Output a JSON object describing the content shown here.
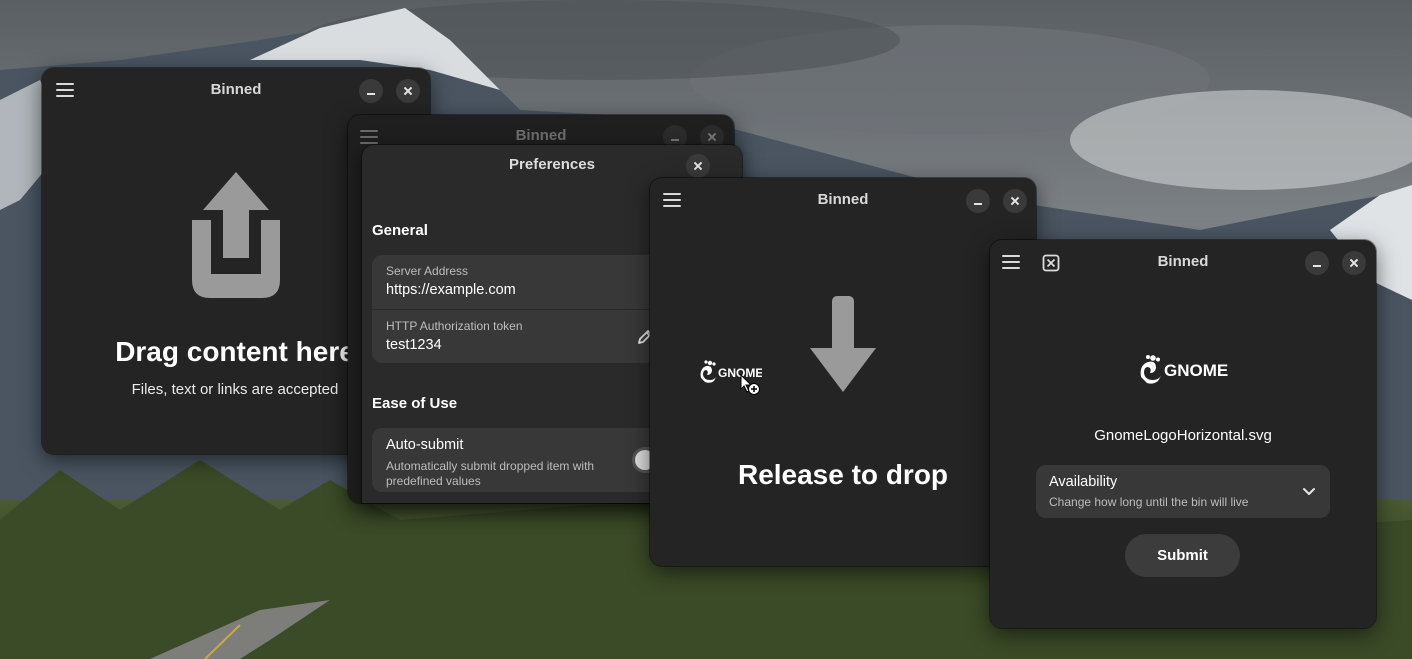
{
  "windows": {
    "main": {
      "title": "Binned",
      "heading": "Drag content here",
      "subtitle": "Files, text or links are accepted"
    },
    "background": {
      "title": "Binned"
    },
    "preferences": {
      "title": "Preferences",
      "general_title": "General",
      "server_address_label": "Server Address",
      "server_address_value": "https://example.com",
      "token_label": "HTTP Authorization token",
      "token_value": "test1234",
      "ease_title": "Ease of Use",
      "auto_submit_title": "Auto-submit",
      "auto_submit_desc": "Automatically submit dropped item with predefined values",
      "auto_submit_enabled": false
    },
    "drop": {
      "title": "Binned",
      "heading": "Release to drop",
      "dragged_item_logo": "GNOME"
    },
    "upload": {
      "title": "Binned",
      "logo_text": "GNOME",
      "filename": "GnomeLogoHorizontal.svg",
      "availability_title": "Availability",
      "availability_desc": "Change how long until the bin will live",
      "submit_label": "Submit"
    }
  },
  "icons": {
    "menu": "hamburger-menu-icon",
    "minimize": "minimize-icon",
    "close": "close-icon",
    "upload": "share-upload-icon",
    "edit": "pencil-edit-icon",
    "drop": "arrow-down-icon",
    "cancel": "cancel-upload-icon",
    "expand": "chevron-down-icon"
  },
  "colors": {
    "window_bg": "#242424",
    "card_bg": "#383838",
    "text": "#ffffff",
    "icon_gray": "#9a9a9a"
  }
}
